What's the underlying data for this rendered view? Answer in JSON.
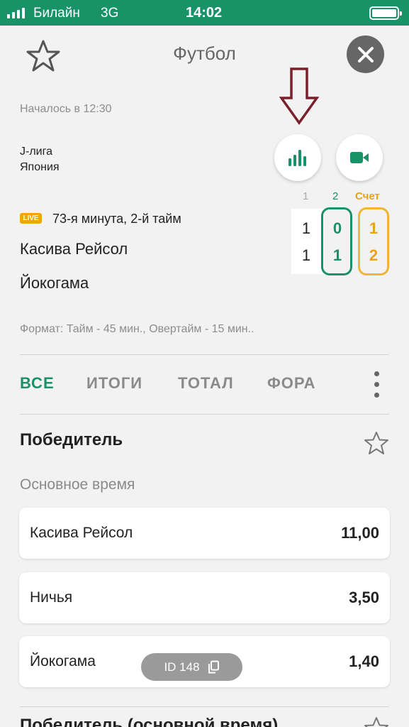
{
  "status_bar": {
    "carrier": "Билайн",
    "network": "3G",
    "time": "14:02",
    "battery_level": 1.0
  },
  "header": {
    "title": "Футбол",
    "favorite_icon": "star-outline-icon",
    "close_icon": "close-icon"
  },
  "match": {
    "started": "Началось в 12:30",
    "league": "J-лига",
    "country": "Япония",
    "live_badge": "LIVE",
    "live_status": "73-я минута, 2-й тайм",
    "home_team": "Касива Рейсол",
    "away_team": "Йокогама",
    "format": "Формат: Тайм - 45 мин., Овертайм - 15 мин..",
    "stats_icon": "bar-chart-icon",
    "video_icon": "video-camera-icon"
  },
  "scoreboard": {
    "headers": [
      "1",
      "2",
      "Счет"
    ],
    "home": [
      "1",
      "0",
      "1"
    ],
    "away": [
      "1",
      "1",
      "2"
    ]
  },
  "tabs": [
    {
      "label": "ВСЕ",
      "active": true
    },
    {
      "label": "ИТОГИ",
      "active": false
    },
    {
      "label": "ТОТАЛ",
      "active": false
    },
    {
      "label": "ФОРА",
      "active": false
    }
  ],
  "market": {
    "title": "Победитель",
    "period": "Основное время",
    "outcomes": [
      {
        "name": "Касива Рейсол",
        "odds": "11,00"
      },
      {
        "name": "Ничья",
        "odds": "3,50"
      },
      {
        "name": "Йокогама",
        "odds": "1,40"
      }
    ]
  },
  "id_pill": {
    "label": "ID 148",
    "icon": "copy-icon"
  },
  "next_market": {
    "title": "Победитель (основной время)"
  },
  "colors": {
    "accent": "#1a9268",
    "score_highlight": "#f0b533",
    "live": "#f0a500",
    "annotation_arrow": "#7a1f2b"
  }
}
